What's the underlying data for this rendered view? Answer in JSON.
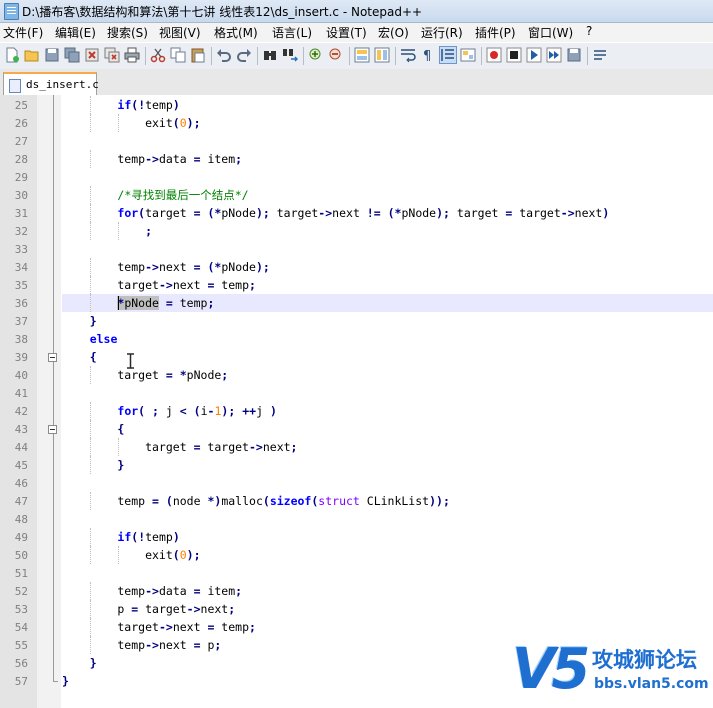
{
  "window": {
    "title": "D:\\播布客\\数据结构和算法\\第十七讲 线性表12\\ds_insert.c - Notepad++"
  },
  "menu": [
    "文件(F)",
    "编辑(E)",
    "搜索(S)",
    "视图(V)",
    "格式(M)",
    "语言(L)",
    "设置(T)",
    "宏(O)",
    "运行(R)",
    "插件(P)",
    "窗口(W)",
    "?"
  ],
  "toolbar_icons": [
    "new-file-icon",
    "open-file-icon",
    "save-icon",
    "save-all-icon",
    "close-icon",
    "close-all-icon",
    "print-icon",
    "cut-icon",
    "copy-icon",
    "paste-icon",
    "undo-icon",
    "redo-icon",
    "find-icon",
    "replace-icon",
    "zoom-in-icon",
    "zoom-out-icon",
    "sync-v-icon",
    "sync-h-icon",
    "word-wrap-icon",
    "show-all-chars-icon",
    "indent-guide-icon",
    "user-lang-icon",
    "record-macro-icon",
    "stop-record-icon",
    "play-macro-icon",
    "play-multiple-icon",
    "save-macro-icon",
    "run-icon"
  ],
  "tab": {
    "label": "ds_insert.c"
  },
  "editor": {
    "current_line": 36,
    "lines": [
      {
        "n": "25",
        "text": "if(!temp)"
      },
      {
        "n": "26",
        "text": "exit(0);"
      },
      {
        "n": "27",
        "text": ""
      },
      {
        "n": "28",
        "text": "temp->data = item;"
      },
      {
        "n": "29",
        "text": ""
      },
      {
        "n": "30",
        "text": "/*寻找到最后一个结点*/"
      },
      {
        "n": "31",
        "text": "for(target = (*pNode); target->next != (*pNode); target = target->next)"
      },
      {
        "n": "32",
        "text": ";"
      },
      {
        "n": "33",
        "text": ""
      },
      {
        "n": "34",
        "text": "temp->next = (*pNode);"
      },
      {
        "n": "35",
        "text": "target->next = temp;"
      },
      {
        "n": "36",
        "text": "*pNode = temp;"
      },
      {
        "n": "37",
        "text": "}"
      },
      {
        "n": "38",
        "text": "else"
      },
      {
        "n": "39",
        "text": "{"
      },
      {
        "n": "40",
        "text": "target = *pNode;"
      },
      {
        "n": "41",
        "text": ""
      },
      {
        "n": "42",
        "text": "for( ; j < (i-1); ++j )"
      },
      {
        "n": "43",
        "text": "{"
      },
      {
        "n": "44",
        "text": "target = target->next;"
      },
      {
        "n": "45",
        "text": "}"
      },
      {
        "n": "46",
        "text": ""
      },
      {
        "n": "47",
        "text": "temp = (node *)malloc(sizeof(struct CLinkList));"
      },
      {
        "n": "48",
        "text": ""
      },
      {
        "n": "49",
        "text": "if(!temp)"
      },
      {
        "n": "50",
        "text": "exit(0);"
      },
      {
        "n": "51",
        "text": ""
      },
      {
        "n": "52",
        "text": "temp->data = item;"
      },
      {
        "n": "53",
        "text": "p = target->next;"
      },
      {
        "n": "54",
        "text": "target->next = temp;"
      },
      {
        "n": "55",
        "text": "temp->next = p;"
      },
      {
        "n": "56",
        "text": "}"
      },
      {
        "n": "57",
        "text": "}"
      }
    ]
  },
  "watermark": {
    "logo": "V5",
    "name": "攻城狮论坛",
    "url": "bbs.vlan5.com"
  },
  "colors": {
    "keyword": "#0000ff",
    "type": "#8000ff",
    "number": "#ff8000",
    "comment": "#008000",
    "tab_accent": "#f7a94e",
    "current_line": "#e8e8ff"
  }
}
